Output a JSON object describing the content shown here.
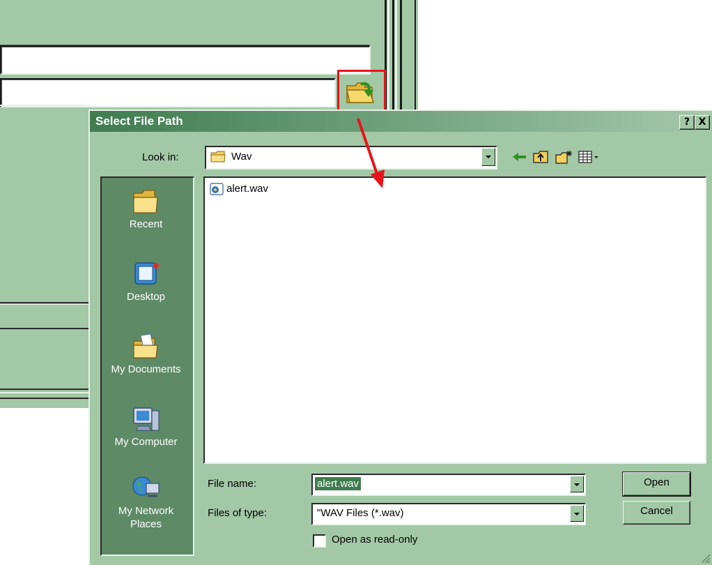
{
  "dialog": {
    "title": "Select File Path",
    "help_button": "?",
    "close_button": "X",
    "look_in_label": "Look in:",
    "look_in_value": "Wav",
    "toolbar_icons": [
      "back-icon",
      "up-folder-icon",
      "new-folder-icon",
      "view-menu-icon"
    ],
    "places": [
      {
        "label": "Recent",
        "icon": "recent-folder-icon"
      },
      {
        "label": "Desktop",
        "icon": "desktop-icon"
      },
      {
        "label": "My Documents",
        "icon": "my-documents-icon"
      },
      {
        "label": "My Computer",
        "icon": "my-computer-icon"
      },
      {
        "label": "My Network Places",
        "icon": "network-places-icon"
      }
    ],
    "files": [
      {
        "name": "alert.wav",
        "icon": "wav-file-icon"
      }
    ],
    "file_name_label": "File name:",
    "file_name_value": "alert.wav",
    "file_type_label": "Files of type:",
    "file_type_value": "\"WAV Files (*.wav)",
    "read_only_label": "Open as read-only",
    "read_only_checked": false,
    "open_button": "Open",
    "cancel_button": "Cancel"
  },
  "background_window": {
    "browse_icon": "browse-folder-icon"
  },
  "colors": {
    "window_green": "#a3c8a6",
    "places_green": "#5e8a66",
    "title_green": "#3f7c4f",
    "highlight_red": "#e8141c"
  }
}
